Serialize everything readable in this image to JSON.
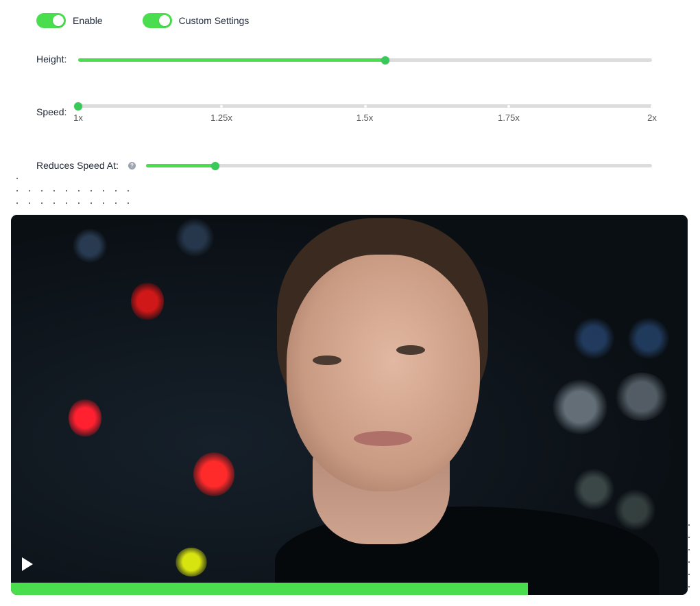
{
  "colors": {
    "accent": "#4ade4f",
    "accent_thumb": "#37c95a",
    "track": "#dcdcdc",
    "text": "#1f2937"
  },
  "toggles": [
    {
      "label": "Enable",
      "on": true
    },
    {
      "label": "Custom Settings",
      "on": true
    }
  ],
  "height": {
    "label": "Height:",
    "value_fraction": 0.535
  },
  "speed": {
    "label": "Speed:",
    "ticks": [
      "1x",
      "1.25x",
      "1.5x",
      "1.75x",
      "2x"
    ],
    "selected_index": 0
  },
  "reduces_speed": {
    "label": "Reduces Speed At:",
    "help_icon": "question-icon",
    "value_fraction": 0.137
  },
  "video": {
    "play_icon": "play-icon",
    "progress_fraction": 0.764
  }
}
